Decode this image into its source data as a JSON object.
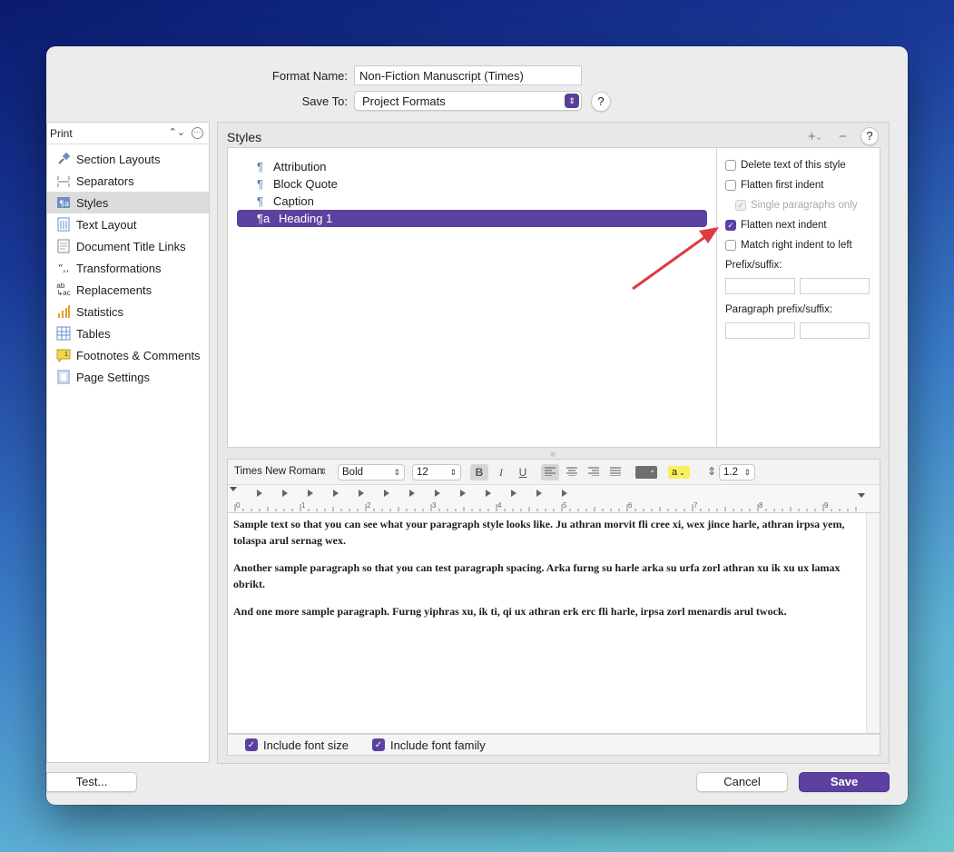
{
  "header": {
    "format_name_label": "Format Name:",
    "format_name_value": "Non-Fiction Manuscript (Times)",
    "save_to_label": "Save To:",
    "save_to_value": "Project Formats",
    "help": "?"
  },
  "sidebar": {
    "mode": "Print",
    "items": [
      {
        "label": "Section Layouts",
        "icon": "paintbrush-icon"
      },
      {
        "label": "Separators",
        "icon": "separator-icon"
      },
      {
        "label": "Styles",
        "icon": "styles-icon"
      },
      {
        "label": "Text Layout",
        "icon": "text-layout-icon"
      },
      {
        "label": "Document Title Links",
        "icon": "document-icon"
      },
      {
        "label": "Transformations",
        "icon": "quotes-icon"
      },
      {
        "label": "Replacements",
        "icon": "replace-icon"
      },
      {
        "label": "Statistics",
        "icon": "bar-chart-icon"
      },
      {
        "label": "Tables",
        "icon": "table-icon"
      },
      {
        "label": "Footnotes & Comments",
        "icon": "footnote-icon"
      },
      {
        "label": "Page Settings",
        "icon": "page-icon"
      }
    ]
  },
  "styles": {
    "title": "Styles",
    "add": "+",
    "remove": "−",
    "help": "?",
    "list": [
      "Attribution",
      "Block Quote",
      "Caption",
      "Heading 1"
    ],
    "selected": "Heading 1",
    "options": {
      "delete_text": "Delete text of this style",
      "flatten_first": "Flatten first indent",
      "single_paragraphs": "Single paragraphs only",
      "flatten_next": "Flatten next indent",
      "match_right": "Match right indent to left",
      "prefix_suffix": "Prefix/suffix:",
      "paragraph_prefix_suffix": "Paragraph prefix/suffix:"
    }
  },
  "format_bar": {
    "font": "Times New Roman",
    "weight": "Bold",
    "size": "12",
    "bold": "B",
    "italic": "I",
    "underline": "U",
    "highlight": "a",
    "line_spacing": "1.2"
  },
  "ruler": {
    "ticks": [
      "0",
      "1",
      "2",
      "3",
      "4",
      "5",
      "6",
      "7",
      "8",
      "9"
    ]
  },
  "editor": {
    "paragraphs": [
      "Sample text so that you can see what your paragraph style looks like. Ju athran morvit fli cree xi, wex jince harle, athran irpsa yem, tolaspa arul sernag wex.",
      "Another sample paragraph so that you can test paragraph spacing. Arka furng su harle arka su urfa zorl athran xu ik xu ux lamax obrikt.",
      "And one more sample paragraph. Furng yiphras xu, ik ti, qi ux athran erk erc fli harle, irpsa zorl menardis arul twock."
    ]
  },
  "bottom": {
    "include_font_size": "Include font size",
    "include_font_family": "Include font family"
  },
  "buttons": {
    "test": "Test...",
    "cancel": "Cancel",
    "save": "Save"
  },
  "colors": {
    "accent": "#5c41a0",
    "annotation_arrow": "#e0393e"
  }
}
